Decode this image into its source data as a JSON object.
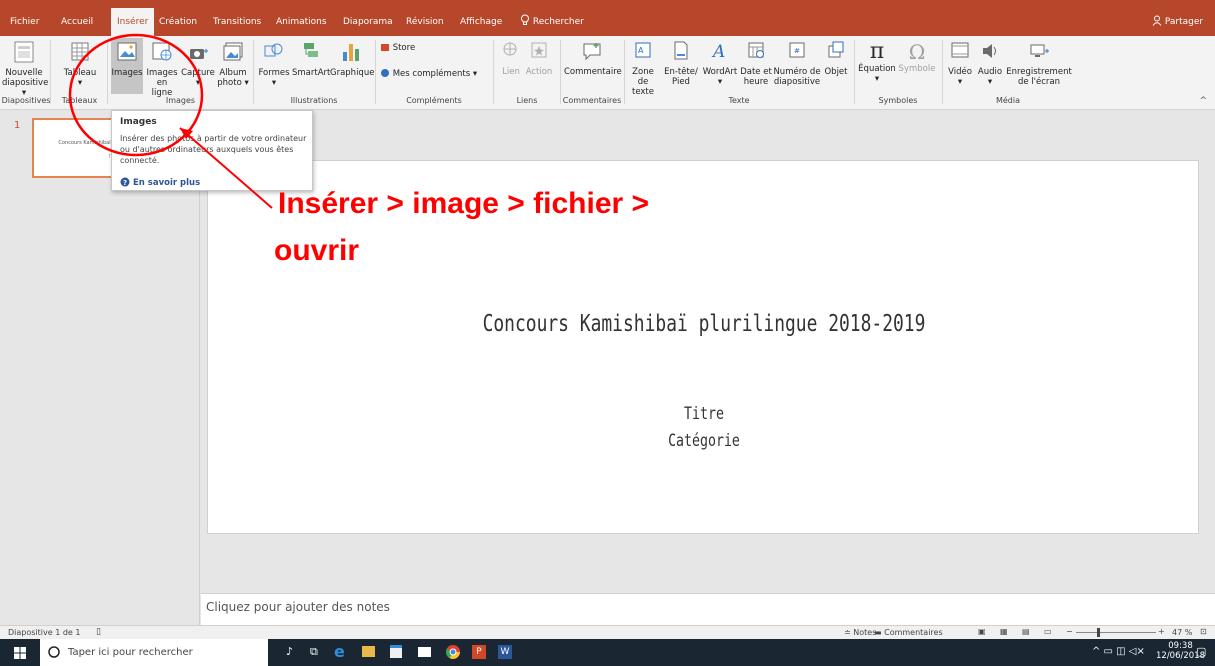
{
  "colors": {
    "accent": "#b7472a",
    "annotation": "#ff0000",
    "thumb_border": "#e6834f"
  },
  "tabs": [
    {
      "label": "Fichier",
      "active": false
    },
    {
      "label": "Accueil",
      "active": false
    },
    {
      "label": "Insérer",
      "active": true
    },
    {
      "label": "Création",
      "active": false
    },
    {
      "label": "Transitions",
      "active": false
    },
    {
      "label": "Animations",
      "active": false
    },
    {
      "label": "Diaporama",
      "active": false
    },
    {
      "label": "Révision",
      "active": false
    },
    {
      "label": "Affichage",
      "active": false
    }
  ],
  "search_label": "Rechercher",
  "share_label": "Partager",
  "ribbon": {
    "new_slide": {
      "line1": "Nouvelle",
      "line2": "diapositive ▾"
    },
    "table": {
      "line1": "Tableau",
      "line2": "▾"
    },
    "images": {
      "line1": "Images"
    },
    "online_images": {
      "line1": "Images",
      "line2": "en ligne"
    },
    "capture": {
      "line1": "Capture",
      "line2": "▾"
    },
    "album": {
      "line1": "Album",
      "line2": "photo ▾"
    },
    "shapes": {
      "line1": "Formes",
      "line2": "▾"
    },
    "smartart": {
      "line1": "SmartArt"
    },
    "chart": {
      "line1": "Graphique"
    },
    "store": "Store",
    "addins": "Mes compléments",
    "link": "Lien",
    "action": "Action",
    "comment": "Commentaire",
    "textbox": {
      "line1": "Zone",
      "line2": "de texte"
    },
    "header": {
      "line1": "En-tête/",
      "line2": "Pied"
    },
    "wordart": {
      "line1": "WordArt",
      "line2": "▾"
    },
    "datetime": {
      "line1": "Date et",
      "line2": "heure"
    },
    "slidenum": {
      "line1": "Numéro de",
      "line2": "diapositive"
    },
    "object": {
      "line1": "Objet"
    },
    "equation": {
      "line1": "Équation",
      "line2": "▾"
    },
    "symbol": {
      "line1": "Symbole"
    },
    "video": {
      "line1": "Vidéo",
      "line2": "▾"
    },
    "audio": {
      "line1": "Audio",
      "line2": "▾"
    },
    "recording": {
      "line1": "Enregistrement",
      "line2": "de l'écran"
    },
    "groups": [
      "Diapositives",
      "Tableaux",
      "Images",
      "Illustrations",
      "Compléments",
      "Liens",
      "Commentaires",
      "Texte",
      "Symboles",
      "Média"
    ]
  },
  "tooltip": {
    "title": "Images",
    "text": "Insérer des photos à partir de votre ordinateur ou d'autres ordinateurs auxquels vous êtes connecté.",
    "link": "En savoir plus"
  },
  "slide_number": "1",
  "slide": {
    "title": "Concours Kamishibaï plurilingue 2018-2019",
    "line1": "Titre",
    "line2": "Catégorie"
  },
  "annotation": {
    "line1": "Insérer > image > fichier >",
    "line2": "ouvrir"
  },
  "notes_placeholder": "Cliquez pour ajouter des notes",
  "status": {
    "slide_count": "Diapositive 1 de 1",
    "notes": "Notes",
    "comments": "Commentaires",
    "zoom": "47 %"
  },
  "taskbar": {
    "search_placeholder": "Taper ici pour rechercher",
    "time": "09:38",
    "date": "12/06/2018"
  }
}
